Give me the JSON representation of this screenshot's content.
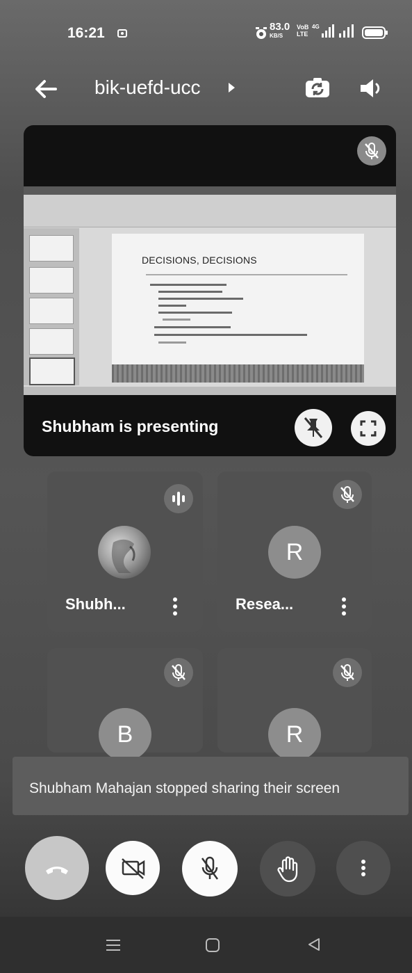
{
  "status_bar": {
    "time": "16:21",
    "net_speed_value": "83.0",
    "net_speed_unit": "KB/S",
    "volte_top": "VoB",
    "volte_bottom": "LTE",
    "network_type": "4G",
    "icons": [
      "screen-record-icon",
      "alarm-icon",
      "signal-icon",
      "signal-icon",
      "battery-icon"
    ]
  },
  "header": {
    "meeting_code": "bik-uefd-ucc",
    "icons": [
      "back-arrow-icon",
      "chevron-right-icon",
      "switch-camera-icon",
      "speaker-icon"
    ]
  },
  "presentation": {
    "presenter_label": "Shubham is presenting",
    "slide_heading": "DECISIONS, DECISIONS",
    "icons": [
      "mic-off-icon",
      "unpin-icon",
      "fullscreen-icon"
    ]
  },
  "participants": [
    {
      "name": "Shubh...",
      "avatar_type": "photo",
      "status_icon": "speaking-indicator-icon"
    },
    {
      "name": "Resea...",
      "avatar_letter": "R",
      "status_icon": "mic-off-icon"
    },
    {
      "name": "",
      "avatar_letter": "B",
      "status_icon": "mic-off-icon"
    },
    {
      "name": "",
      "avatar_letter": "R",
      "status_icon": "mic-off-icon"
    }
  ],
  "toast": {
    "message": "Shubham Mahajan stopped sharing their screen"
  },
  "controls": {
    "icons": [
      "end-call-icon",
      "camera-off-icon",
      "mic-off-icon",
      "raise-hand-icon",
      "more-vert-icon"
    ]
  },
  "nav_bar": {
    "icons": [
      "recents-menu-icon",
      "home-icon",
      "back-triangle-icon"
    ]
  },
  "colors": {
    "background": "#555555",
    "tile": "#515151",
    "toast": "#5d5d5d",
    "control_light": "#fbfbfb",
    "control_dark": "#4f4f4f"
  }
}
